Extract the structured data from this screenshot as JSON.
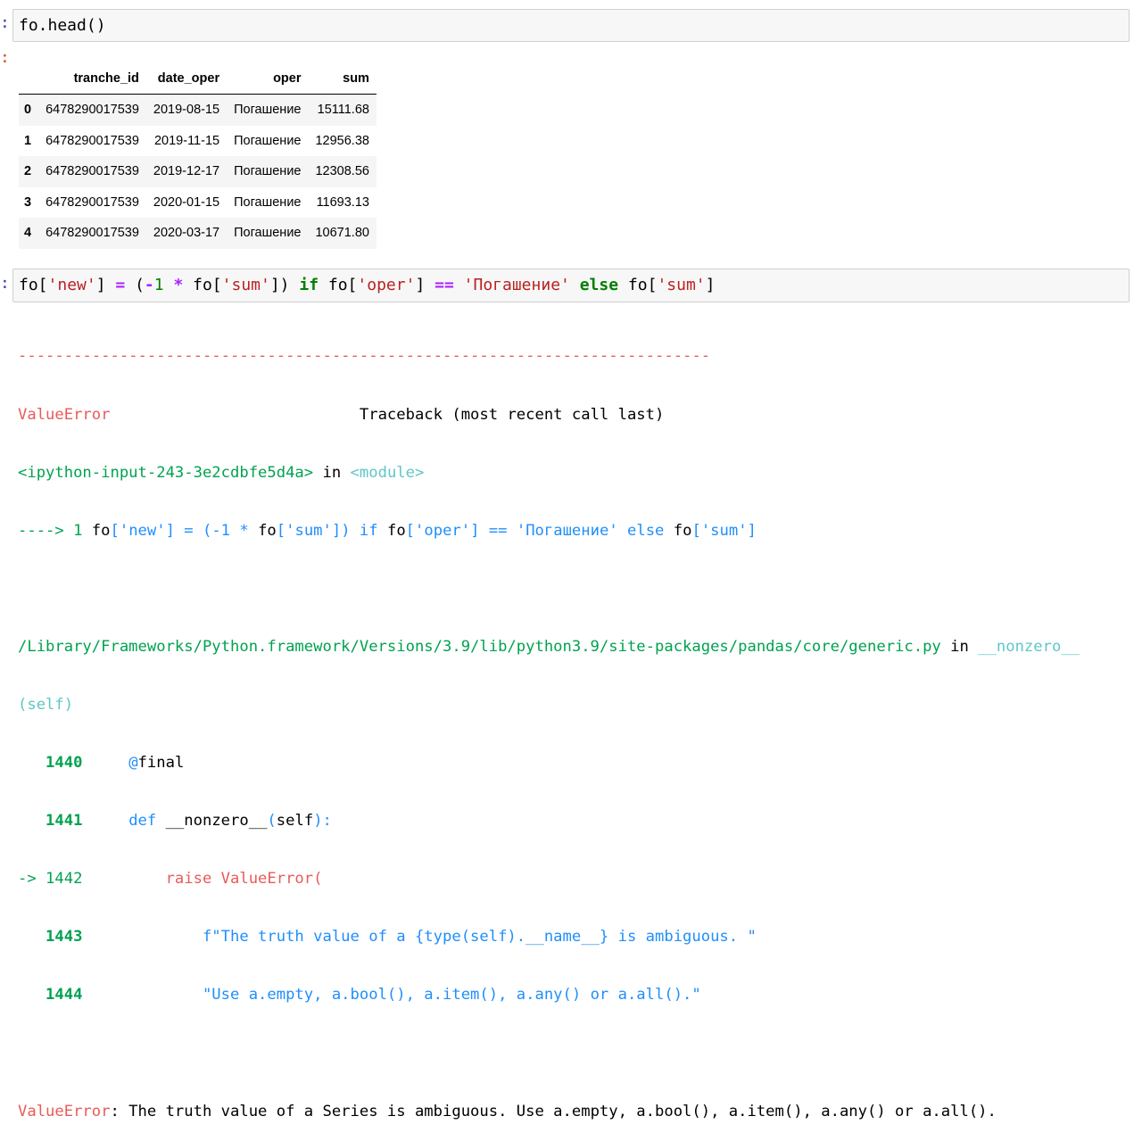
{
  "cell1": {
    "prompt": ":",
    "code": "fo.head()"
  },
  "out1": {
    "prompt": ":"
  },
  "dataframe": {
    "columns": [
      "",
      "tranche_id",
      "date_oper",
      "oper",
      "sum"
    ],
    "rows": [
      {
        "index": "0",
        "tranche_id": "6478290017539",
        "date_oper": "2019-08-15",
        "oper": "Погашение",
        "sum": "15111.68"
      },
      {
        "index": "1",
        "tranche_id": "6478290017539",
        "date_oper": "2019-11-15",
        "oper": "Погашение",
        "sum": "12956.38"
      },
      {
        "index": "2",
        "tranche_id": "6478290017539",
        "date_oper": "2019-12-17",
        "oper": "Погашение",
        "sum": "12308.56"
      },
      {
        "index": "3",
        "tranche_id": "6478290017539",
        "date_oper": "2020-01-15",
        "oper": "Погашение",
        "sum": "11693.13"
      },
      {
        "index": "4",
        "tranche_id": "6478290017539",
        "date_oper": "2020-03-17",
        "oper": "Погашение",
        "sum": "10671.80"
      }
    ]
  },
  "cell2": {
    "prompt": ":",
    "code_parts": [
      "fo[",
      "'new'",
      "] ",
      "=",
      " (",
      "-",
      "1",
      " ",
      "*",
      " fo[",
      "'sum'",
      "]) ",
      "if",
      " fo[",
      "'oper'",
      "] ",
      "==",
      " ",
      "'Погашение'",
      " ",
      "else",
      " fo[",
      "'sum'",
      "]"
    ]
  },
  "traceback": {
    "separator": "---------------------------------------------------------------------------",
    "error_name": "ValueError",
    "header_right": "                           Traceback (most recent call last)",
    "frame1_file": "<ipython-input-243-3e2cdbfe5d4a>",
    "frame1_in": " in ",
    "frame1_module": "<module>",
    "frame1_arrow": "----> 1 ",
    "frame1_code_a": "fo",
    "frame1_code_b": "['new'] = (-1 * ",
    "frame1_code_c": "fo",
    "frame1_code_d": "['sum']) if ",
    "frame1_code_e": "fo",
    "frame1_code_f": "['oper'] == 'Погашение' else ",
    "frame1_code_g": "fo",
    "frame1_code_h": "['sum']",
    "frame2_path": "/Library/Frameworks/Python.framework/Versions/3.9/lib/python3.9/site-packages/pandas/core/generic.py",
    "frame2_in": " in ",
    "frame2_func": "__nonzero__",
    "frame2_self": "(self)",
    "lines": [
      {
        "no": "   1440",
        "pre": "     ",
        "code_blue": "@",
        "code_black": "final"
      },
      {
        "no": "   1441",
        "pre": "     ",
        "code_blue": "def ",
        "code_black": "__nonzero__",
        "tail_blue": "(",
        "tail_black": "self",
        "tail_blue2": "):"
      }
    ],
    "line1442_arrow": "-> 1442",
    "line1442_code": "         raise ValueError(",
    "line1443_no": "   1443",
    "line1443_code": "             f\"The truth value of a {type(self).__name__} is ambiguous. \"",
    "line1444_no": "   1444",
    "line1444_code": "             \"Use a.empty, a.bool(), a.item(), a.any() or a.all().\"",
    "final_error": "ValueError",
    "final_message": ": The truth value of a Series is ambiguous. Use a.empty, a.bool(), a.item(), a.any() or a.all()."
  }
}
